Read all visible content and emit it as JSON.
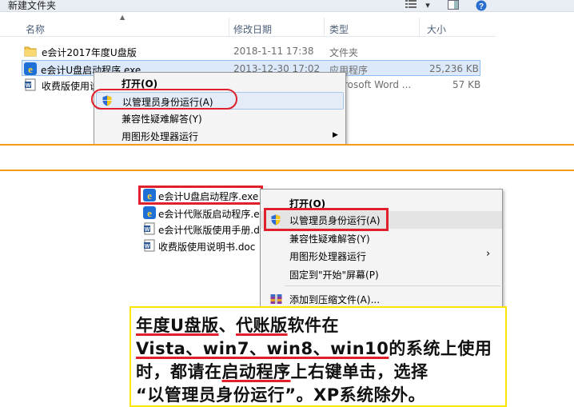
{
  "top": {
    "title": "新建文件夹",
    "toolbar": {
      "view_icon": "view-icon",
      "help": "?"
    },
    "columns": {
      "name": "名称",
      "date": "修改日期",
      "type": "类型",
      "size": "大小"
    },
    "rows": [
      {
        "name": "e会计2017年度U盘版",
        "date": "2018-1-11 17:38",
        "type": "文件夹",
        "size": ""
      },
      {
        "name": "e会计U盘启动程序.exe",
        "date": "2013-12-30 17:02",
        "type": "应用程序",
        "size": "25,236 KB"
      },
      {
        "name": "收费版使用说",
        "date": "",
        "type": "rosoft Word ...",
        "size": "57 KB"
      }
    ],
    "menu": {
      "open": "打开(O)",
      "run_as_admin": "以管理员身份运行(A)",
      "compat": "兼容性疑难解答(Y)",
      "gpu": "用图形处理器运行"
    }
  },
  "bottom": {
    "files": [
      "e会计U盘启动程序.exe",
      "e会计代账版启动程序.e",
      "e会计代账版使用手册.d",
      "收费版使用说明书.doc"
    ],
    "menu": {
      "open": "打开(O)",
      "run_as_admin": "以管理员身份运行(A)",
      "compat": "兼容性疑难解答(Y)",
      "gpu": "用图形处理器运行",
      "pin": "固定到\"开始\"屏幕(P)",
      "archive": "添加到压缩文件(A)..."
    }
  },
  "note": {
    "l1a": "年度U盘版",
    "l1b": "、",
    "l1c": "代账版",
    "l1d": "软件在",
    "l2": "Vista、win7、win8、win10",
    "l2b": "的系统上使用",
    "l3a": "时，都请在",
    "l3b": "启动程序",
    "l3c": "上右键单击，选择",
    "l4": "“以管理员身份运行”。XP系统除外。"
  },
  "colors": {
    "accent_red": "#e0202a",
    "separator": "#f39b1c",
    "note_border": "#ffe600"
  }
}
